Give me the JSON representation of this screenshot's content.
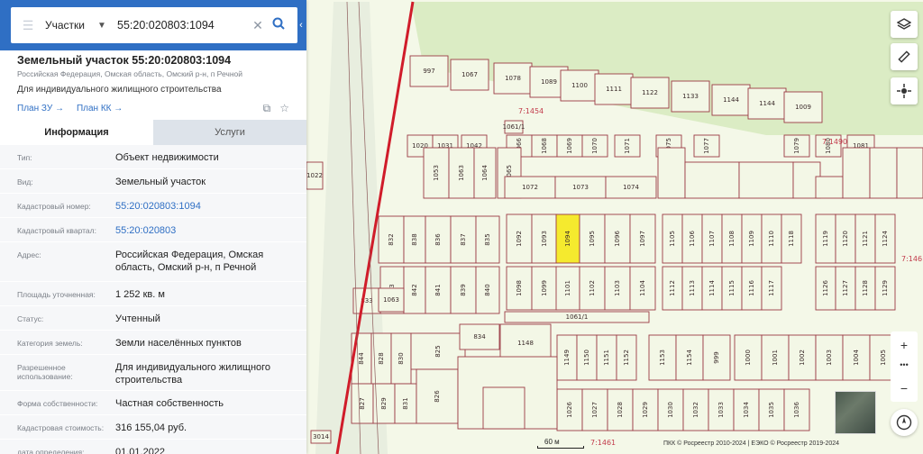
{
  "search": {
    "type_label": "Участки",
    "query": "55:20:020803:1094"
  },
  "object": {
    "title": "Земельный участок 55:20:020803:1094",
    "address_short": "Российская Федерация, Омская область, Омский р-н, п Речной",
    "purpose": "Для индивидуального жилищного строительства",
    "plan_zu": "План ЗУ →",
    "plan_kk": "План КК →"
  },
  "tabs": {
    "info": "Информация",
    "services": "Услуги"
  },
  "info_rows": [
    {
      "k": "Тип:",
      "v": "Объект недвижимости"
    },
    {
      "k": "Вид:",
      "v": "Земельный участок"
    },
    {
      "k": "Кадастровый номер:",
      "v": "55:20:020803:1094"
    },
    {
      "k": "Кадастровый квартал:",
      "v": "55:20:020803"
    },
    {
      "k": "Адрес:",
      "v": "Российская Федерация, Омская область, Омский р-н, п Речной"
    },
    {
      "k": "Площадь уточненная:",
      "v": "1 252 кв. м"
    },
    {
      "k": "Статус:",
      "v": "Учтенный"
    },
    {
      "k": "Категория земель:",
      "v": "Земли населённых пунктов"
    },
    {
      "k": "Разрешенное использование:",
      "v": "Для индивидуального жилищного строительства"
    },
    {
      "k": "Форма собственности:",
      "v": "Частная собственность"
    },
    {
      "k": "Кадастровая стоимость:",
      "v": "316 155,04 руб."
    },
    {
      "k": "дата определения:",
      "v": "01.01.2022"
    }
  ],
  "map": {
    "scale_label": "60 м",
    "copyright": "ПКК © Росреестр 2010-2024 | ЕЭКО © Росреестр 2019-2024",
    "quarter_labels": [
      "7:1454",
      "7:1490",
      "7:146",
      "7:1461"
    ],
    "plot_labels": {
      "r1": [
        "997",
        "1067",
        "1078",
        "1089",
        "1100",
        "1111",
        "1122",
        "1133",
        "1144",
        "1144",
        "1009"
      ],
      "r2": [
        "1020",
        "1031",
        "1042",
        "1066",
        "1068",
        "1069",
        "1070",
        "1071",
        "1075",
        "1077",
        "1079",
        "1080",
        "1081"
      ],
      "r3": [
        "1053",
        "1063",
        "1064",
        "1065",
        "1072",
        "1073",
        "1074"
      ],
      "r4": [
        "832",
        "838",
        "836",
        "837",
        "835",
        "1092",
        "1093",
        "1094",
        "1095",
        "1096",
        "1097",
        "1105",
        "1106",
        "1107",
        "1108",
        "1109",
        "1110",
        "1118",
        "1119",
        "1120",
        "1121",
        "1124"
      ],
      "r5": [
        "833",
        "843",
        "842",
        "841",
        "839",
        "840",
        "1098",
        "1099",
        "1101",
        "1102",
        "1103",
        "1104",
        "1112",
        "1113",
        "1114",
        "1115",
        "1116",
        "1117",
        "1126",
        "1127",
        "1128",
        "1129"
      ],
      "r6": [
        "844",
        "828",
        "830",
        "825",
        "834",
        "1148",
        "1149",
        "1150",
        "1151",
        "1152",
        "1153",
        "1154",
        "999",
        "1000",
        "1001",
        "1002",
        "1003",
        "1004",
        "1005"
      ],
      "r7": [
        "827",
        "829",
        "831",
        "826",
        "1026",
        "1027",
        "1028",
        "1029",
        "1030",
        "1032",
        "1033",
        "1034",
        "1035",
        "1036"
      ],
      "misc": [
        "1022",
        "1061/1",
        "1063",
        "3014",
        "1061/1"
      ]
    }
  },
  "controls": {
    "layers": "layers-icon",
    "ruler": "ruler-icon",
    "locate": "crosshair-icon",
    "zoom_in": "+",
    "more": "•••",
    "zoom_out": "−",
    "compass": "compass-icon"
  },
  "colors": {
    "header": "#2f6fc4",
    "boundary": "#9b3a44",
    "road": "#d01c2a",
    "selected": "#f5ea2e"
  }
}
